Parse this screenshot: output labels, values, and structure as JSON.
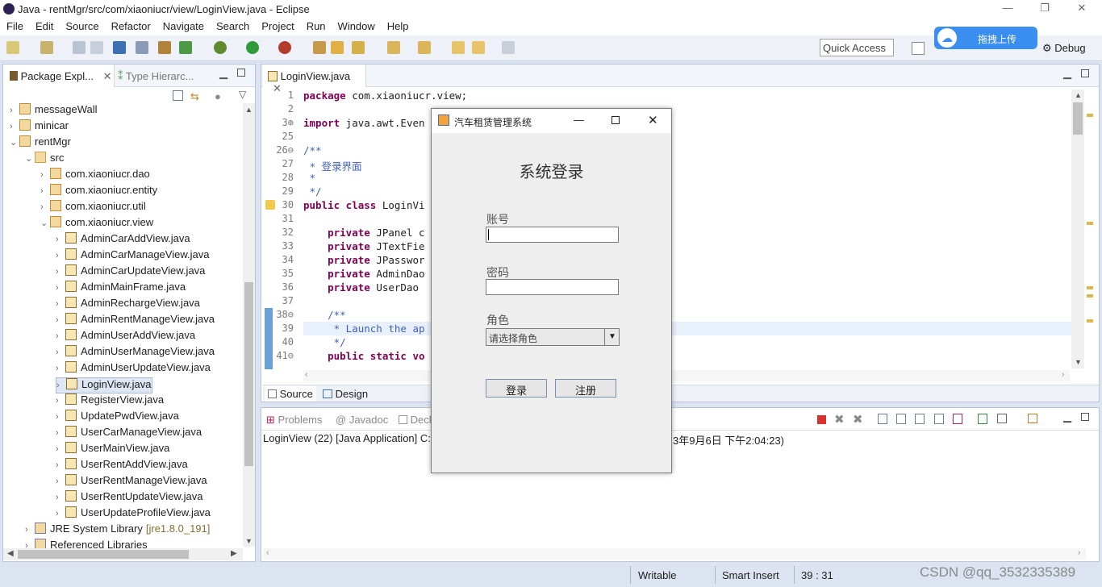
{
  "window": {
    "title": "Java - rentMgr/src/com/xiaoniucr/view/LoginView.java - Eclipse"
  },
  "menu": [
    "File",
    "Edit",
    "Source",
    "Refactor",
    "Navigate",
    "Search",
    "Project",
    "Run",
    "Window",
    "Help"
  ],
  "quick_access": "Quick Access",
  "upload_button": "拖拽上传",
  "perspectives": {
    "debug": "Debug"
  },
  "package_explorer": {
    "tab1": "Package Expl...",
    "tab2": "Type Hierarc...",
    "items": [
      {
        "label": "messageWall",
        "indent": 0,
        "type": "project",
        "exp": "›"
      },
      {
        "label": "minicar",
        "indent": 0,
        "type": "project",
        "exp": "›"
      },
      {
        "label": "rentMgr",
        "indent": 0,
        "type": "project",
        "exp": "⌄"
      },
      {
        "label": "src",
        "indent": 1,
        "type": "src",
        "exp": "⌄"
      },
      {
        "label": "com.xiaoniucr.dao",
        "indent": 2,
        "type": "pkg",
        "exp": "›"
      },
      {
        "label": "com.xiaoniucr.entity",
        "indent": 2,
        "type": "pkg",
        "exp": "›"
      },
      {
        "label": "com.xiaoniucr.util",
        "indent": 2,
        "type": "pkg",
        "exp": "›"
      },
      {
        "label": "com.xiaoniucr.view",
        "indent": 2,
        "type": "pkg",
        "exp": "⌄"
      },
      {
        "label": "AdminCarAddView.java",
        "indent": 3,
        "type": "java",
        "exp": "›"
      },
      {
        "label": "AdminCarManageView.java",
        "indent": 3,
        "type": "java",
        "exp": "›"
      },
      {
        "label": "AdminCarUpdateView.java",
        "indent": 3,
        "type": "java",
        "exp": "›"
      },
      {
        "label": "AdminMainFrame.java",
        "indent": 3,
        "type": "java",
        "exp": "›"
      },
      {
        "label": "AdminRechargeView.java",
        "indent": 3,
        "type": "java",
        "exp": "›"
      },
      {
        "label": "AdminRentManageView.java",
        "indent": 3,
        "type": "java",
        "exp": "›"
      },
      {
        "label": "AdminUserAddView.java",
        "indent": 3,
        "type": "java",
        "exp": "›"
      },
      {
        "label": "AdminUserManageView.java",
        "indent": 3,
        "type": "java",
        "exp": "›"
      },
      {
        "label": "AdminUserUpdateView.java",
        "indent": 3,
        "type": "java",
        "exp": "›"
      },
      {
        "label": "LoginView.java",
        "indent": 3,
        "type": "java",
        "exp": "›",
        "selected": true
      },
      {
        "label": "RegisterView.java",
        "indent": 3,
        "type": "java",
        "exp": "›"
      },
      {
        "label": "UpdatePwdView.java",
        "indent": 3,
        "type": "java",
        "exp": "›"
      },
      {
        "label": "UserCarManageView.java",
        "indent": 3,
        "type": "java",
        "exp": "›"
      },
      {
        "label": "UserMainView.java",
        "indent": 3,
        "type": "java",
        "exp": "›"
      },
      {
        "label": "UserRentAddView.java",
        "indent": 3,
        "type": "java",
        "exp": "›"
      },
      {
        "label": "UserRentManageView.java",
        "indent": 3,
        "type": "java",
        "exp": "›"
      },
      {
        "label": "UserRentUpdateView.java",
        "indent": 3,
        "type": "java",
        "exp": "›"
      },
      {
        "label": "UserUpdateProfileView.java",
        "indent": 3,
        "type": "java",
        "exp": "›"
      },
      {
        "label": "JRE System Library",
        "suffix": "[jre1.8.0_191]",
        "indent": 1,
        "type": "lib",
        "exp": "›"
      },
      {
        "label": "Referenced Libraries",
        "indent": 1,
        "type": "lib",
        "exp": "›"
      }
    ]
  },
  "editor": {
    "tab": "LoginView.java",
    "lines": [
      {
        "n": "1",
        "html": "<span class='kw'>package</span> com.xiaoniucr.view;"
      },
      {
        "n": "2",
        "html": ""
      },
      {
        "n": "3⊕",
        "html": "<span class='kw'>import</span> java.awt.Even"
      },
      {
        "n": "25",
        "html": ""
      },
      {
        "n": "26⊖",
        "html": "<span class='cm'>/**</span>"
      },
      {
        "n": "27",
        "html": "<span class='cm'> * 登录界面</span>"
      },
      {
        "n": "28",
        "html": "<span class='cm'> *</span>"
      },
      {
        "n": "29",
        "html": "<span class='cm'> */</span>"
      },
      {
        "n": "30",
        "html": "<span class='kw'>public class</span> LoginVi"
      },
      {
        "n": "31",
        "html": ""
      },
      {
        "n": "32",
        "html": "    <span class='kw'>private</span> JPanel c"
      },
      {
        "n": "33",
        "html": "    <span class='kw'>private</span> JTextFie"
      },
      {
        "n": "34",
        "html": "    <span class='kw'>private</span> JPasswor"
      },
      {
        "n": "35",
        "html": "    <span class='kw'>private</span> AdminDao"
      },
      {
        "n": "36",
        "html": "    <span class='kw'>private</span> UserDao "
      },
      {
        "n": "37",
        "html": ""
      },
      {
        "n": "38⊖",
        "html": "    <span class='cm'>/**</span>"
      },
      {
        "n": "39",
        "html": "<span class='cm'>     * Launch the ap</span>"
      },
      {
        "n": "40",
        "html": "<span class='cm'>     */</span>"
      },
      {
        "n": "41⊖",
        "html": "    <span class='kw'>public static</span> <span class='kw'>vo</span>"
      }
    ],
    "bottom_tabs": [
      "Source",
      "Design"
    ]
  },
  "bottom_panel": {
    "tabs": [
      "Problems",
      "Javadoc",
      "Decl"
    ],
    "console_line": "LoginView (22) [Java Application] C:\\",
    "console_suffix": "3年9月6日 下午2:04:23)"
  },
  "dialog": {
    "title": "汽车租赁管理系统",
    "heading": "系统登录",
    "account_label": "账号",
    "password_label": "密码",
    "role_label": "角色",
    "role_placeholder": "请选择角色",
    "login_button": "登录",
    "register_button": "注册"
  },
  "status": {
    "writable": "Writable",
    "insert_mode": "Smart Insert",
    "position": "39 : 31"
  },
  "watermark": "CSDN @qq_3532335389"
}
